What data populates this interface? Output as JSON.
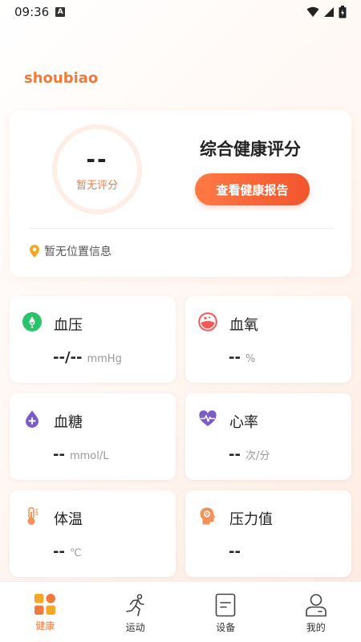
{
  "status_bar": {
    "time": "09:36"
  },
  "app": {
    "name": "shoubiao"
  },
  "score_card": {
    "score": "--",
    "score_label": "暂无评分",
    "title": "综合健康评分",
    "report_button": "查看健康报告",
    "location": "暂无位置信息"
  },
  "metrics": [
    {
      "name": "血压",
      "value": "--/--",
      "unit": "mmHg",
      "icon": "blood-pressure-icon",
      "color": "#2bc36a"
    },
    {
      "name": "血氧",
      "value": "--",
      "unit": "%",
      "icon": "blood-oxygen-icon",
      "color": "#f25a5a"
    },
    {
      "name": "血糖",
      "value": "--",
      "unit": "mmol/L",
      "icon": "blood-sugar-icon",
      "color": "#7b5cc9"
    },
    {
      "name": "心率",
      "value": "--",
      "unit": "次/分",
      "icon": "heart-rate-icon",
      "color": "#7b5cc9"
    },
    {
      "name": "体温",
      "value": "--",
      "unit": "℃",
      "icon": "thermometer-icon",
      "color": "#f2925a"
    },
    {
      "name": "压力值",
      "value": "--",
      "unit": "",
      "icon": "stress-icon",
      "color": "#f2925a"
    }
  ],
  "tabs": [
    {
      "label": "健康",
      "icon": "health-grid-icon",
      "active": true
    },
    {
      "label": "运动",
      "icon": "running-icon",
      "active": false
    },
    {
      "label": "设备",
      "icon": "device-icon",
      "active": false
    },
    {
      "label": "我的",
      "icon": "profile-icon",
      "active": false
    }
  ],
  "colors": {
    "accent": "#f07a3a",
    "button_start": "#ff7a45",
    "button_end": "#f2542d"
  }
}
